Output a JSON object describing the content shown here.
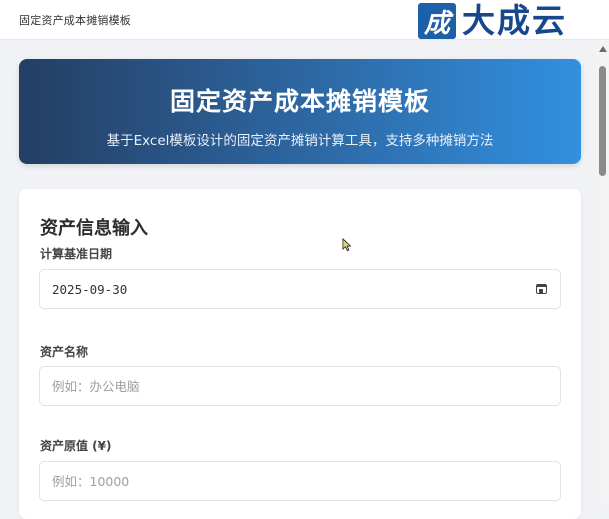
{
  "window": {
    "tab_title": "固定资产成本摊销模板"
  },
  "logo": {
    "mark": "成",
    "text": "大成云"
  },
  "hero": {
    "title": "固定资产成本摊销模板",
    "subtitle": "基于Excel模板设计的固定资产摊销计算工具，支持多种摊销方法"
  },
  "asset_form": {
    "title": "资产信息输入",
    "fields": {
      "base_date": {
        "label": "计算基准日期",
        "value": "2025-09-30",
        "icon": "calendar-icon"
      },
      "asset_name": {
        "label": "资产名称",
        "value": "",
        "placeholder": "例如：办公电脑"
      },
      "original_value": {
        "label": "资产原值 (¥)",
        "value": "",
        "placeholder": "例如：10000"
      }
    }
  },
  "colors": {
    "hero_gradient_start": "#243e63",
    "hero_gradient_end": "#3190e0",
    "logo_brand": "#17478c",
    "page_background": "#f0f2f5"
  }
}
